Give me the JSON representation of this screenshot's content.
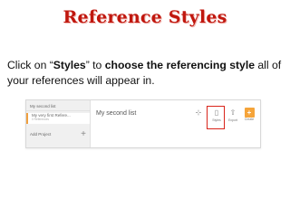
{
  "slide": {
    "title": "Reference Styles",
    "instruction": {
      "p1": "Click on “",
      "styles_word": "Styles",
      "p2": "” to ",
      "emphasis": "choose the referencing style",
      "p3": " all of your references will appear in."
    }
  },
  "screenshot": {
    "sidebar": {
      "items": [
        {
          "label": "My second list"
        },
        {
          "label": "My very first Refere...",
          "sub": "0 References"
        },
        {
          "label": "Add Project"
        }
      ]
    },
    "main": {
      "list_title": "My second list",
      "toolbar": {
        "styles_label": "Styles",
        "export_label": "Export",
        "create_label": "Create"
      }
    },
    "colors": {
      "title": "#c0170e",
      "highlight": "#d9241a",
      "create_button": "#f5a43a"
    },
    "icons": [
      "user-add-icon",
      "styles-icon",
      "export-icon",
      "plus-icon"
    ]
  }
}
